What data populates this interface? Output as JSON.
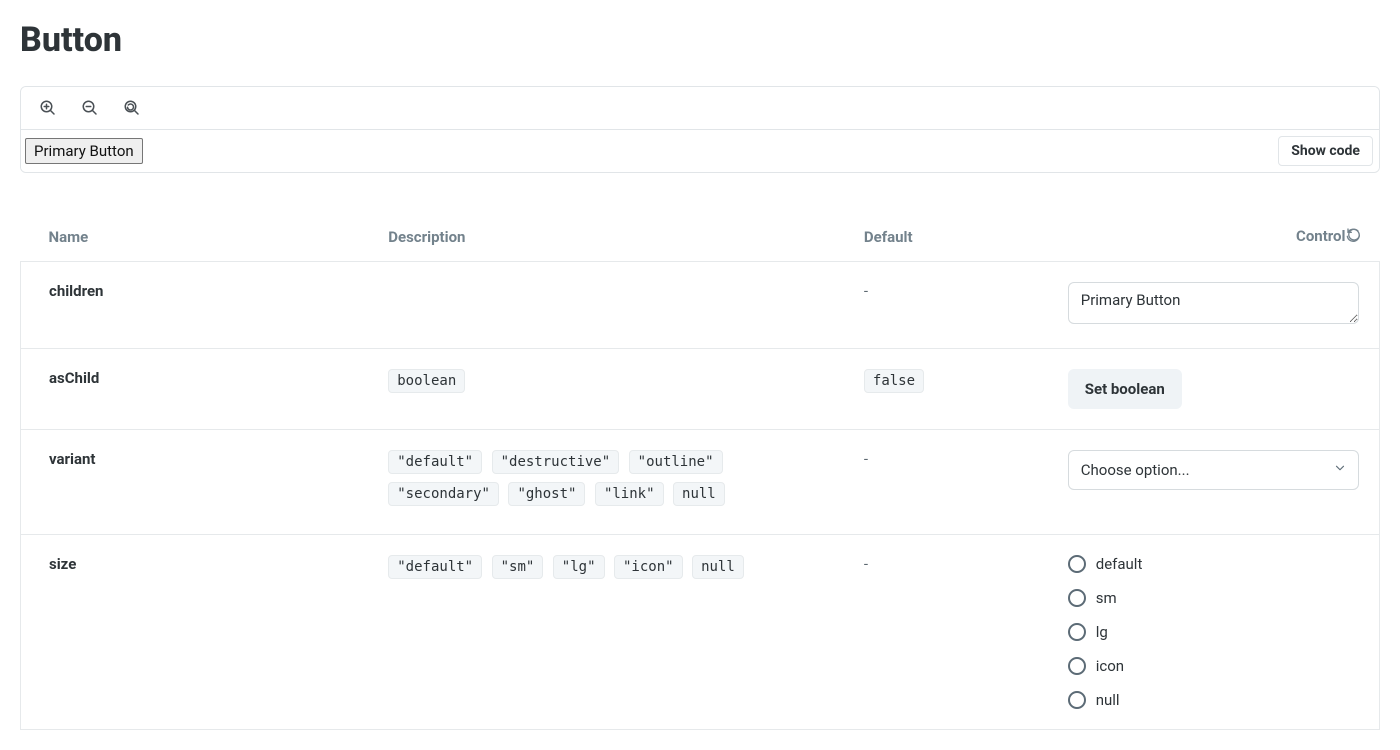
{
  "page": {
    "title": "Button"
  },
  "preview": {
    "rendered_label": "Primary Button",
    "show_code_label": "Show code"
  },
  "columns": {
    "name": "Name",
    "description": "Description",
    "default": "Default",
    "control": "Control"
  },
  "controls": {
    "children": {
      "name": "children",
      "default": "-",
      "value": "Primary Button"
    },
    "asChild": {
      "name": "asChild",
      "type": "boolean",
      "default": "false",
      "button_label": "Set boolean"
    },
    "variant": {
      "name": "variant",
      "options": [
        "\"default\"",
        "\"destructive\"",
        "\"outline\"",
        "\"secondary\"",
        "\"ghost\"",
        "\"link\"",
        "null"
      ],
      "default": "-",
      "placeholder": "Choose option..."
    },
    "size": {
      "name": "size",
      "options": [
        "\"default\"",
        "\"sm\"",
        "\"lg\"",
        "\"icon\"",
        "null"
      ],
      "default": "-",
      "radio_options": [
        "default",
        "sm",
        "lg",
        "icon",
        "null"
      ]
    }
  }
}
